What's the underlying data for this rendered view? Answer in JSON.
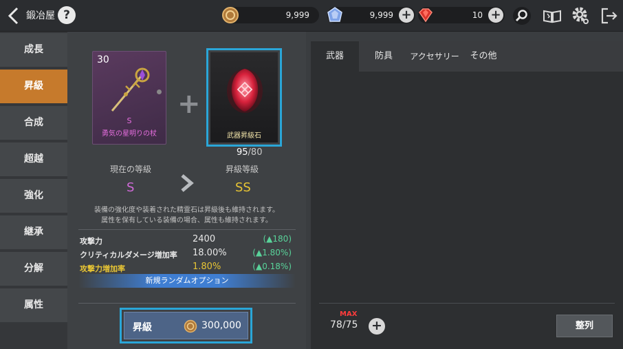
{
  "header": {
    "title": "鍛冶屋",
    "help": "?",
    "currencies": [
      {
        "icon": "gold-coin-icon",
        "amount": "9,999"
      },
      {
        "icon": "blue-crystal-icon",
        "amount": "9,999"
      },
      {
        "icon": "red-gem-icon",
        "amount": "10"
      }
    ],
    "plus": "+"
  },
  "sidebar": {
    "items": [
      {
        "label": "成長",
        "active": false
      },
      {
        "label": "昇級",
        "active": true
      },
      {
        "label": "合成",
        "active": false
      },
      {
        "label": "超越",
        "active": false
      },
      {
        "label": "強化",
        "active": false
      },
      {
        "label": "継承",
        "active": false
      },
      {
        "label": "分解",
        "active": false
      },
      {
        "label": "属性",
        "active": false
      }
    ]
  },
  "upgrade": {
    "equipment": {
      "level": "30",
      "grade": "S",
      "name": "勇気の星明りの杖"
    },
    "material": {
      "name": "武器昇級石",
      "owned": "95",
      "required": "/80"
    },
    "current_grade_label": "現在の等級",
    "current_grade": "S",
    "next_grade_label": "昇級等級",
    "next_grade": "SS",
    "note_line1": "装備の強化度や装着された精霊石は昇級後も維持されます。",
    "note_line2": "属性を保有している装備の場合、属性も維持されます。",
    "stats": [
      {
        "name": "攻撃力",
        "value": "2400",
        "delta": "(▲180)",
        "highlight": false
      },
      {
        "name": "クリティカルダメージ増加率",
        "value": "18.00%",
        "delta": "(▲1.80%)",
        "highlight": false
      },
      {
        "name": "攻撃力増加率",
        "value": "1.80%",
        "delta": "(▲0.18%)",
        "highlight": true
      }
    ],
    "new_option": "新規ランダムオプション",
    "button_label": "昇級",
    "cost": "300,000"
  },
  "inventory": {
    "tabs": [
      {
        "label": "武器",
        "active": true
      },
      {
        "label": "防具",
        "active": false
      },
      {
        "label": "アクセサリー",
        "active": false
      },
      {
        "label": "その他",
        "active": false
      }
    ],
    "max_label": "MAX",
    "capacity": "78/75",
    "sort_label": "整列"
  },
  "colors": {
    "accent_orange": "#c67a2c",
    "highlight_blue": "#2aa6d8",
    "grade_s": "#d06ad8",
    "grade_ss": "#e8c534",
    "delta_green": "#59d39a"
  }
}
